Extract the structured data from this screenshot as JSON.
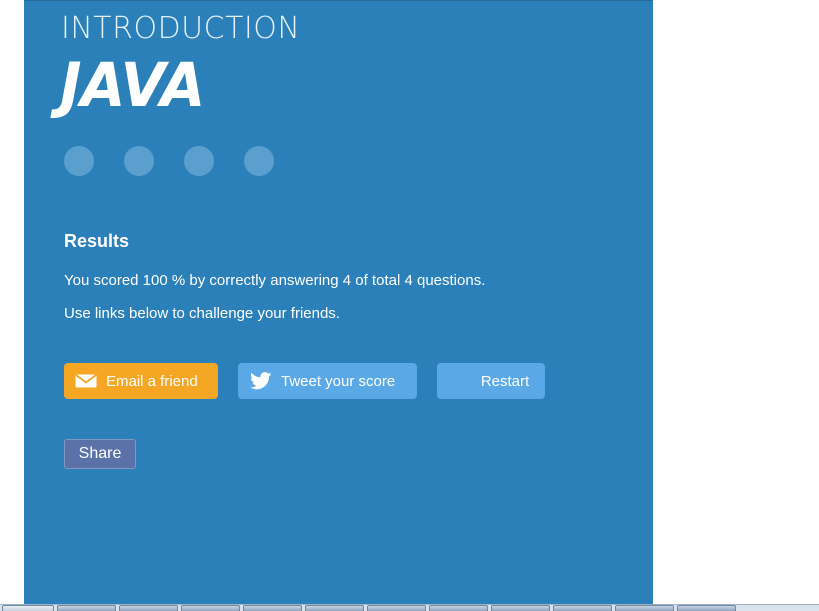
{
  "header": {
    "intro": "INTRODUCTION",
    "title": "JAVA"
  },
  "progress": {
    "total_questions": 4,
    "dots": [
      "question-1",
      "question-2",
      "question-3",
      "question-4"
    ]
  },
  "results": {
    "heading": "Results",
    "score_text": "You scored 100 % by correctly answering 4 of total 4 questions.",
    "challenge_text": "Use links below to challenge your friends."
  },
  "actions": {
    "email_label": "Email a friend",
    "tweet_label": "Tweet your score",
    "restart_label": "Restart",
    "share_label": "Share"
  },
  "icons": {
    "email": "envelope-icon",
    "tweet": "twitter-bird-icon"
  },
  "colors": {
    "panel_bg": "#2b80b9",
    "email_button": "#f5a623",
    "tweet_button": "#5aa9e6",
    "restart_button": "#5aa9e6",
    "share_button": "#5a72a8",
    "progress_dot": "#5b9fcf"
  }
}
